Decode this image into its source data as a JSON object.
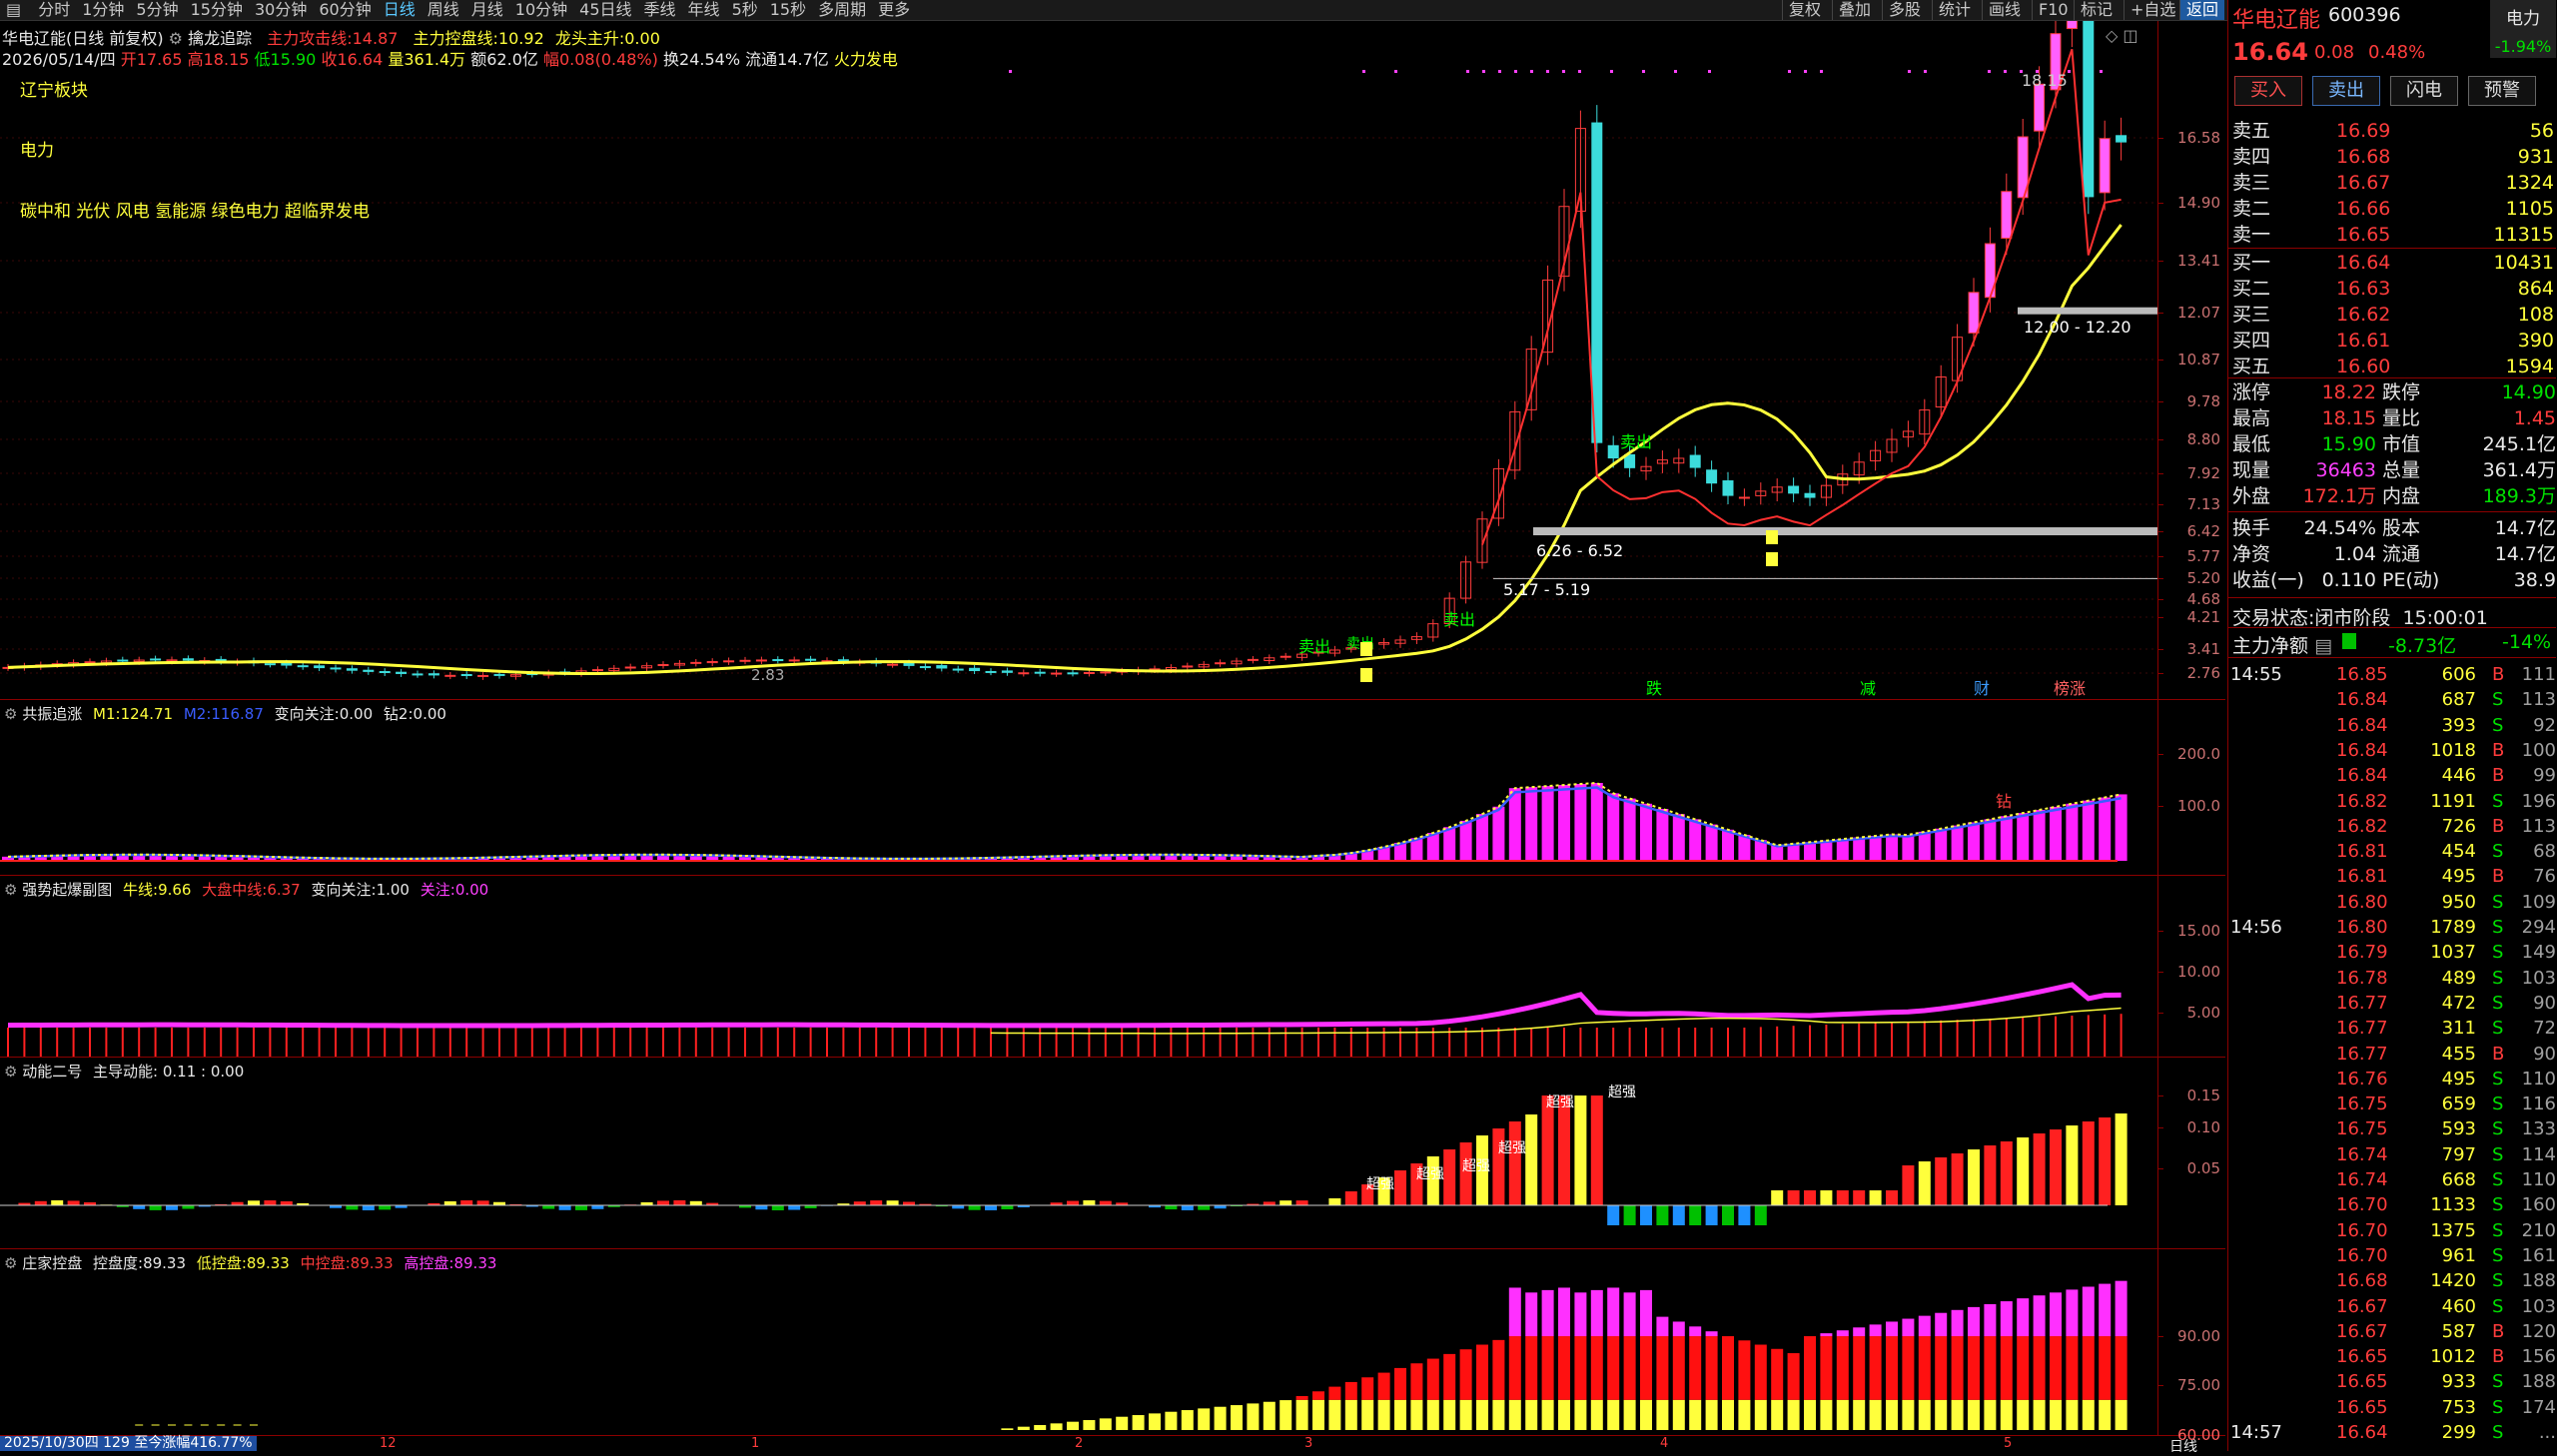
{
  "toolbar": {
    "tabs": [
      "分时",
      "1分钟",
      "5分钟",
      "15分钟",
      "30分钟",
      "60分钟",
      "日线",
      "周线",
      "月线",
      "10分钟",
      "45日线",
      "季线",
      "年线",
      "5秒",
      "15秒",
      "多周期",
      "更多"
    ],
    "active": "日线",
    "right_buttons": [
      "复权",
      "叠加",
      "多股",
      "统计",
      "画线",
      "F10",
      "标记",
      "+自选",
      "返回"
    ]
  },
  "main_panel": {
    "title": "华电辽能(日线 前复权)",
    "indicator": "擒龙追踪",
    "line1_label": "主力攻击线:",
    "line1_value": "14.87",
    "line2_label": "主力控盘线:",
    "line2_value": "10.92",
    "line3_label": "龙头主升:",
    "line3_value": "0.00",
    "info_date": "2026/05/14/四",
    "info_open": "开17.65",
    "info_high": "高18.15",
    "info_low": "低15.90",
    "info_close": "收16.64",
    "info_vol": "量361.4万",
    "info_amt": "额62.0亿",
    "info_chg": "幅0.08(0.48%)",
    "info_turn": "换24.54%",
    "info_float": "流通14.7亿",
    "info_concept": "火力发电",
    "tag_region": "辽宁板块",
    "tag_industry": "电力",
    "tag_concepts": "碳中和 光伏 风电 氢能源 绿色电力 超临界发电",
    "price_labels": [
      "18.15",
      "12.00 - 12.20",
      "6.26 - 6.52",
      "5.17 - 5.19",
      "2.83"
    ],
    "sell_labels": [
      "卖出",
      "卖出",
      "卖出",
      "卖出"
    ],
    "bottom_marks": [
      "跌",
      "减",
      "财",
      "榜涨"
    ],
    "yticks": [
      "16.58",
      "14.90",
      "13.41",
      "12.07",
      "10.87",
      "9.78",
      "8.80",
      "7.92",
      "7.13",
      "6.42",
      "5.77",
      "5.20",
      "4.68",
      "4.21",
      "3.41",
      "2.76"
    ]
  },
  "panel2": {
    "name": "共振追涨",
    "m1_label": "M1:",
    "m1": "124.71",
    "m2_label": "M2:",
    "m2": "116.87",
    "focus_label": "变向关注:",
    "focus": "0.00",
    "dig_label": "钻2:",
    "dig": "0.00",
    "yticks": [
      "200.0",
      "100.0"
    ],
    "mark": "钻"
  },
  "panel3": {
    "name": "强势起爆副图",
    "bull_label": "牛线:",
    "bull": "9.66",
    "mid_label": "大盘中线:",
    "mid": "6.37",
    "focus_label": "变向关注:",
    "focus": "1.00",
    "watch_label": "关注:",
    "watch": "0.00",
    "yticks": [
      "15.00",
      "10.00",
      "5.00"
    ]
  },
  "panel4": {
    "name": "动能二号",
    "lead_label": "主导动能:",
    "lead": "0.11 : 0.00",
    "yticks": [
      "0.15",
      "0.10",
      "0.05"
    ],
    "mark": "超强"
  },
  "panel5": {
    "name": "庄家控盘",
    "ctrl_label": "控盘度:",
    "ctrl": "89.33",
    "low_label": "低控盘:",
    "low": "89.33",
    "mid_label": "中控盘:",
    "mid": "89.33",
    "high_label": "高控盘:",
    "high": "89.33",
    "yticks": [
      "90.00",
      "75.00",
      "60.00"
    ]
  },
  "status_bar": {
    "text": "2025/10/30四 129 至今涨幅416.77%",
    "x_labels": [
      "12",
      "1",
      "2",
      "3",
      "4",
      "5"
    ],
    "period": "日线"
  },
  "quote": {
    "name": "华电辽能",
    "code": "600396",
    "sector": "电力",
    "sector_chg": "-1.94%",
    "price": "16.64",
    "change": "0.08",
    "change_pct": "0.48%",
    "buttons": [
      "买入",
      "卖出",
      "闪电",
      "预警"
    ],
    "asks": [
      {
        "label": "卖五",
        "price": "16.69",
        "vol": "56"
      },
      {
        "label": "卖四",
        "price": "16.68",
        "vol": "931"
      },
      {
        "label": "卖三",
        "price": "16.67",
        "vol": "1324"
      },
      {
        "label": "卖二",
        "price": "16.66",
        "vol": "1105"
      },
      {
        "label": "卖一",
        "price": "16.65",
        "vol": "11315"
      }
    ],
    "bids": [
      {
        "label": "买一",
        "price": "16.64",
        "vol": "10431"
      },
      {
        "label": "买二",
        "price": "16.63",
        "vol": "864"
      },
      {
        "label": "买三",
        "price": "16.62",
        "vol": "108"
      },
      {
        "label": "买四",
        "price": "16.61",
        "vol": "390"
      },
      {
        "label": "买五",
        "price": "16.60",
        "vol": "1594"
      }
    ],
    "stats": [
      {
        "l1": "涨停",
        "v1": "18.22",
        "l2": "跌停",
        "v2": "14.90"
      },
      {
        "l1": "最高",
        "v1": "18.15",
        "l2": "量比",
        "v2": "1.45"
      },
      {
        "l1": "最低",
        "v1": "15.90",
        "l2": "市值",
        "v2": "245.1亿"
      },
      {
        "l1": "现量",
        "v1": "36463",
        "l2": "总量",
        "v2": "361.4万"
      },
      {
        "l1": "外盘",
        "v1": "172.1万",
        "l2": "内盘",
        "v2": "189.3万"
      }
    ],
    "stats2": [
      {
        "l1": "换手",
        "v1": "24.54%",
        "l2": "股本",
        "v2": "14.7亿"
      },
      {
        "l1": "净资",
        "v1": "1.04",
        "l2": "流通",
        "v2": "14.7亿"
      },
      {
        "l1": "收益(一)",
        "v1": "0.110",
        "l2": "PE(动)",
        "v2": "38.9"
      }
    ],
    "trade_state_label": "交易状态:",
    "trade_state": "闭市阶段",
    "trade_time": "15:00:01",
    "net_label": "主力净额",
    "net_value": "-8.73亿",
    "net_pct": "-14%"
  },
  "ticks": [
    {
      "t": "14:55",
      "p": "16.85",
      "v": "606",
      "d": "B",
      "n": "111"
    },
    {
      "t": "",
      "p": "16.84",
      "v": "687",
      "d": "S",
      "n": "113"
    },
    {
      "t": "",
      "p": "16.84",
      "v": "393",
      "d": "S",
      "n": "92"
    },
    {
      "t": "",
      "p": "16.84",
      "v": "1018",
      "d": "B",
      "n": "100"
    },
    {
      "t": "",
      "p": "16.84",
      "v": "446",
      "d": "B",
      "n": "99"
    },
    {
      "t": "",
      "p": "16.82",
      "v": "1191",
      "d": "S",
      "n": "196"
    },
    {
      "t": "",
      "p": "16.82",
      "v": "726",
      "d": "B",
      "n": "113"
    },
    {
      "t": "",
      "p": "16.81",
      "v": "454",
      "d": "S",
      "n": "68"
    },
    {
      "t": "",
      "p": "16.81",
      "v": "495",
      "d": "B",
      "n": "76"
    },
    {
      "t": "",
      "p": "16.80",
      "v": "950",
      "d": "S",
      "n": "109"
    },
    {
      "t": "14:56",
      "p": "16.80",
      "v": "1789",
      "d": "S",
      "n": "294"
    },
    {
      "t": "",
      "p": "16.79",
      "v": "1037",
      "d": "S",
      "n": "149"
    },
    {
      "t": "",
      "p": "16.78",
      "v": "489",
      "d": "S",
      "n": "103"
    },
    {
      "t": "",
      "p": "16.77",
      "v": "472",
      "d": "S",
      "n": "90"
    },
    {
      "t": "",
      "p": "16.77",
      "v": "311",
      "d": "S",
      "n": "72"
    },
    {
      "t": "",
      "p": "16.77",
      "v": "455",
      "d": "B",
      "n": "90"
    },
    {
      "t": "",
      "p": "16.76",
      "v": "495",
      "d": "S",
      "n": "110"
    },
    {
      "t": "",
      "p": "16.75",
      "v": "659",
      "d": "S",
      "n": "116"
    },
    {
      "t": "",
      "p": "16.75",
      "v": "593",
      "d": "S",
      "n": "133"
    },
    {
      "t": "",
      "p": "16.74",
      "v": "797",
      "d": "S",
      "n": "114"
    },
    {
      "t": "",
      "p": "16.74",
      "v": "668",
      "d": "S",
      "n": "110"
    },
    {
      "t": "",
      "p": "16.70",
      "v": "1133",
      "d": "S",
      "n": "160"
    },
    {
      "t": "",
      "p": "16.70",
      "v": "1375",
      "d": "S",
      "n": "210"
    },
    {
      "t": "",
      "p": "16.70",
      "v": "961",
      "d": "S",
      "n": "161"
    },
    {
      "t": "",
      "p": "16.68",
      "v": "1420",
      "d": "S",
      "n": "188"
    },
    {
      "t": "",
      "p": "16.67",
      "v": "460",
      "d": "S",
      "n": "103"
    },
    {
      "t": "",
      "p": "16.67",
      "v": "587",
      "d": "B",
      "n": "120"
    },
    {
      "t": "",
      "p": "16.65",
      "v": "1012",
      "d": "B",
      "n": "156"
    },
    {
      "t": "",
      "p": "16.65",
      "v": "933",
      "d": "S",
      "n": "188"
    },
    {
      "t": "",
      "p": "16.65",
      "v": "753",
      "d": "S",
      "n": "174"
    },
    {
      "t": "14:57",
      "p": "16.64",
      "v": "299",
      "d": "S",
      "n": "..."
    }
  ],
  "colors": {
    "up": "#ff3c3c",
    "down": "#3cdcdc",
    "ma": "#ffff3c",
    "panel_border": "#8b0000",
    "accent": "#1e5aa0"
  }
}
